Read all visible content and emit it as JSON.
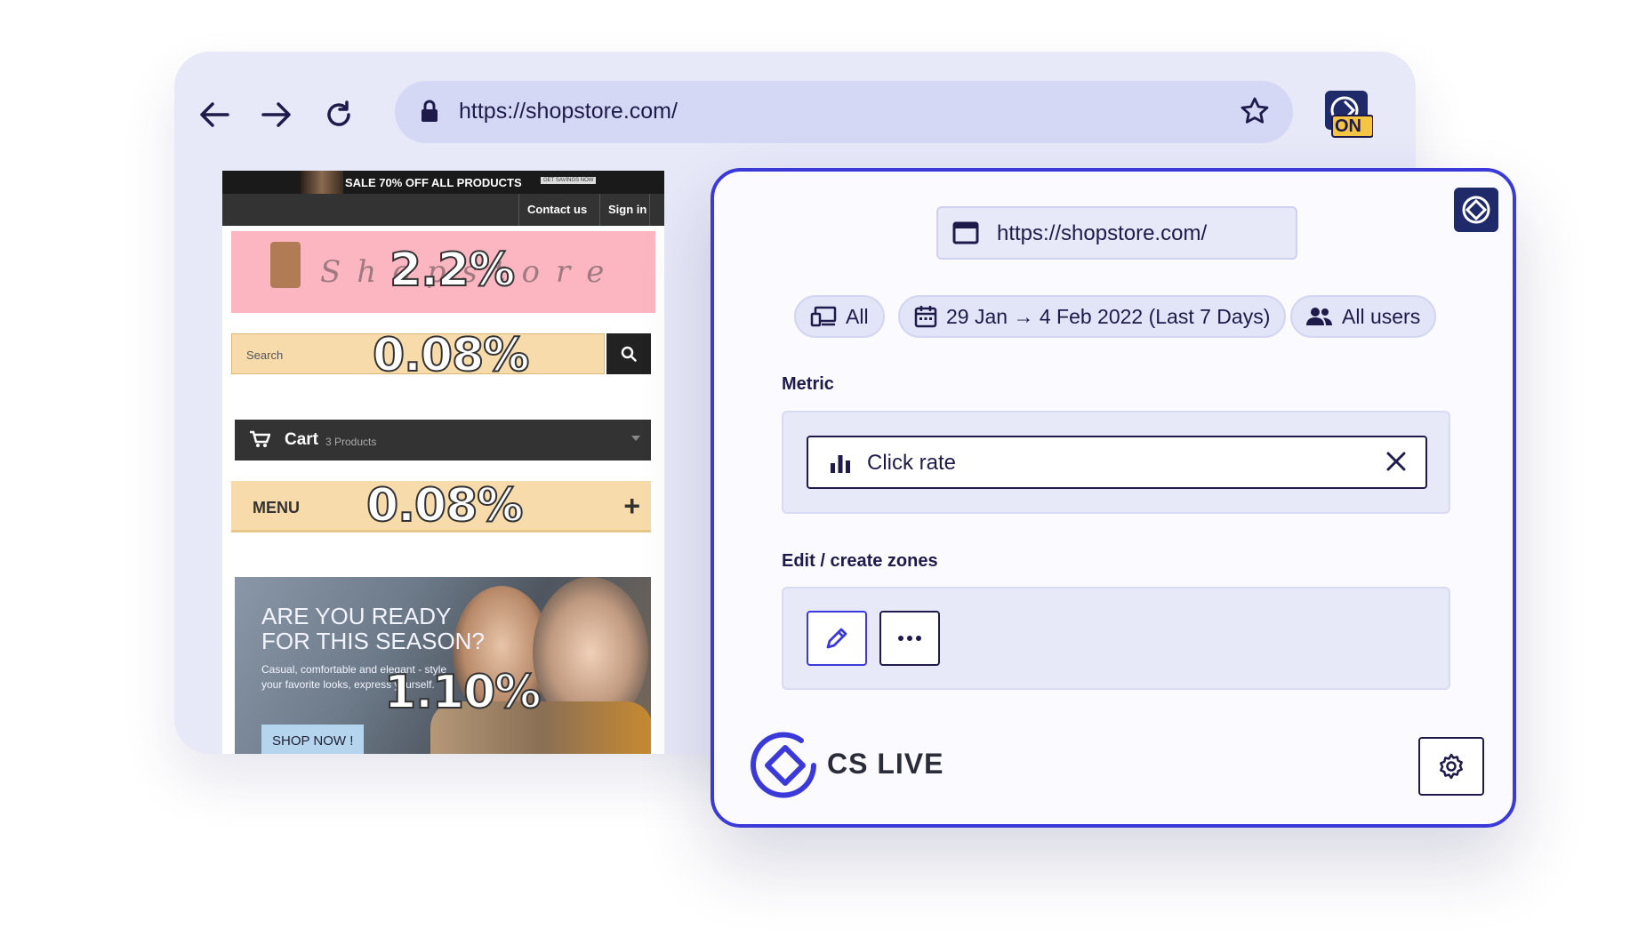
{
  "browser": {
    "url": "https://shopstore.com/",
    "extension_badge": "ON"
  },
  "site": {
    "promo_text": "SALE 70% OFF ALL PRODUCTS",
    "promo_tag": "GET SAVINGS NOW",
    "contact_link": "Contact us",
    "signin_link": "Sign in",
    "logo_text": "Shopstore",
    "search_placeholder": "Search",
    "cart_label": "Cart",
    "cart_count": "3 Products",
    "menu_label": "MENU",
    "menu_plus": "+",
    "banner_headline": "ARE YOU READY FOR THIS SEASON?",
    "banner_desc": "Casual, comfortable and elegant - style your favorite looks, express yourself.",
    "banner_cta": "SHOP NOW !",
    "zones": {
      "logo": "2.2%",
      "search": "0.08%",
      "menu": "0.08%",
      "banner": "1.10%"
    }
  },
  "panel": {
    "url": "https://shopstore.com/",
    "device_filter": "All",
    "date_filter": "29 Jan → 4 Feb 2022 (Last 7 Days)",
    "segment_filter": "All users",
    "metric_label": "Metric",
    "metric_value": "Click rate",
    "zones_label": "Edit / create zones",
    "brand_name": "CS LIVE",
    "accent_color": "#3b3ad8"
  }
}
